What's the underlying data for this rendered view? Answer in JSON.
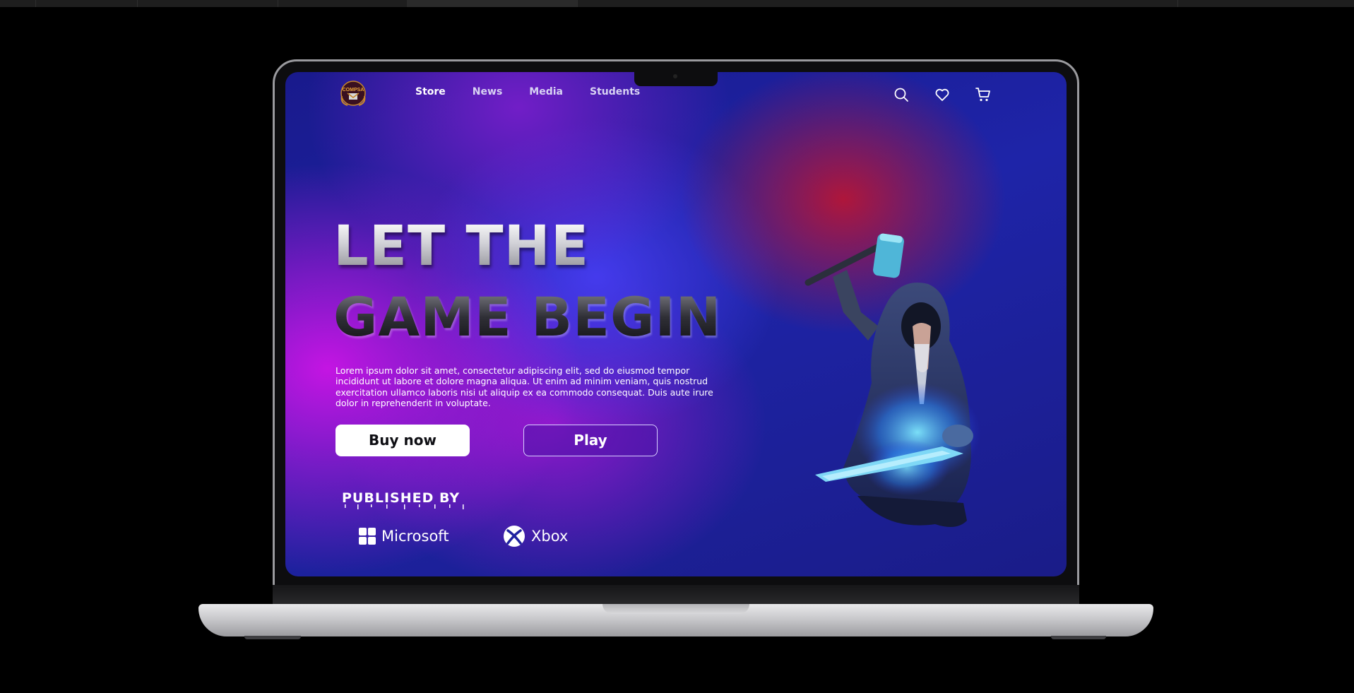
{
  "nav": {
    "logo_text": "COMPSA",
    "items": [
      {
        "label": "Store",
        "active": true
      },
      {
        "label": "News",
        "active": false
      },
      {
        "label": "Media",
        "active": false
      },
      {
        "label": "Students",
        "active": false
      }
    ],
    "icons": [
      "search-icon",
      "heart-icon",
      "cart-icon"
    ]
  },
  "hero": {
    "line1": "LET THE",
    "line2": "GAME BEGIN",
    "description": "Lorem ipsum dolor sit amet, consectetur adipiscing elit, sed do eiusmod tempor incididunt ut labore et dolore magna aliqua. Ut enim ad minim veniam, quis nostrud exercitation ullamco laboris nisi ut aliquip ex ea commodo consequat. Duis aute irure dolor in reprehenderit in voluptate."
  },
  "buttons": {
    "buy_label": "Buy now",
    "play_label": "Play"
  },
  "publishers": {
    "heading": "PUBLISHED BY",
    "items": [
      {
        "name": "Microsoft",
        "icon": "microsoft-logo-icon"
      },
      {
        "name": "Xbox",
        "icon": "xbox-logo-icon"
      }
    ]
  },
  "colors": {
    "accent_purple": "#c81ae6",
    "accent_blue": "#3c3ef0",
    "accent_red": "#c81428",
    "background_navy": "#1a1c8c"
  }
}
